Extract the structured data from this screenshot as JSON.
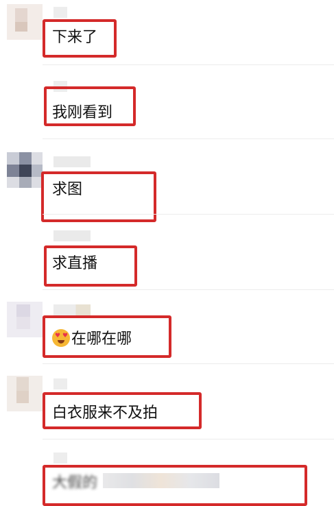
{
  "comments": [
    {
      "text": "下来了"
    },
    {
      "text": "我刚看到"
    },
    {
      "text": "求图"
    },
    {
      "text": "求直播"
    },
    {
      "text": "在哪在哪",
      "emoji": "heart-eyes-emoji-icon"
    },
    {
      "text": "白衣服来不及拍"
    },
    {
      "text": "大假的",
      "partially_obscured": true
    }
  ],
  "colors": {
    "highlight_border": "#d42a2a",
    "divider": "#ececec",
    "text": "#111111"
  }
}
